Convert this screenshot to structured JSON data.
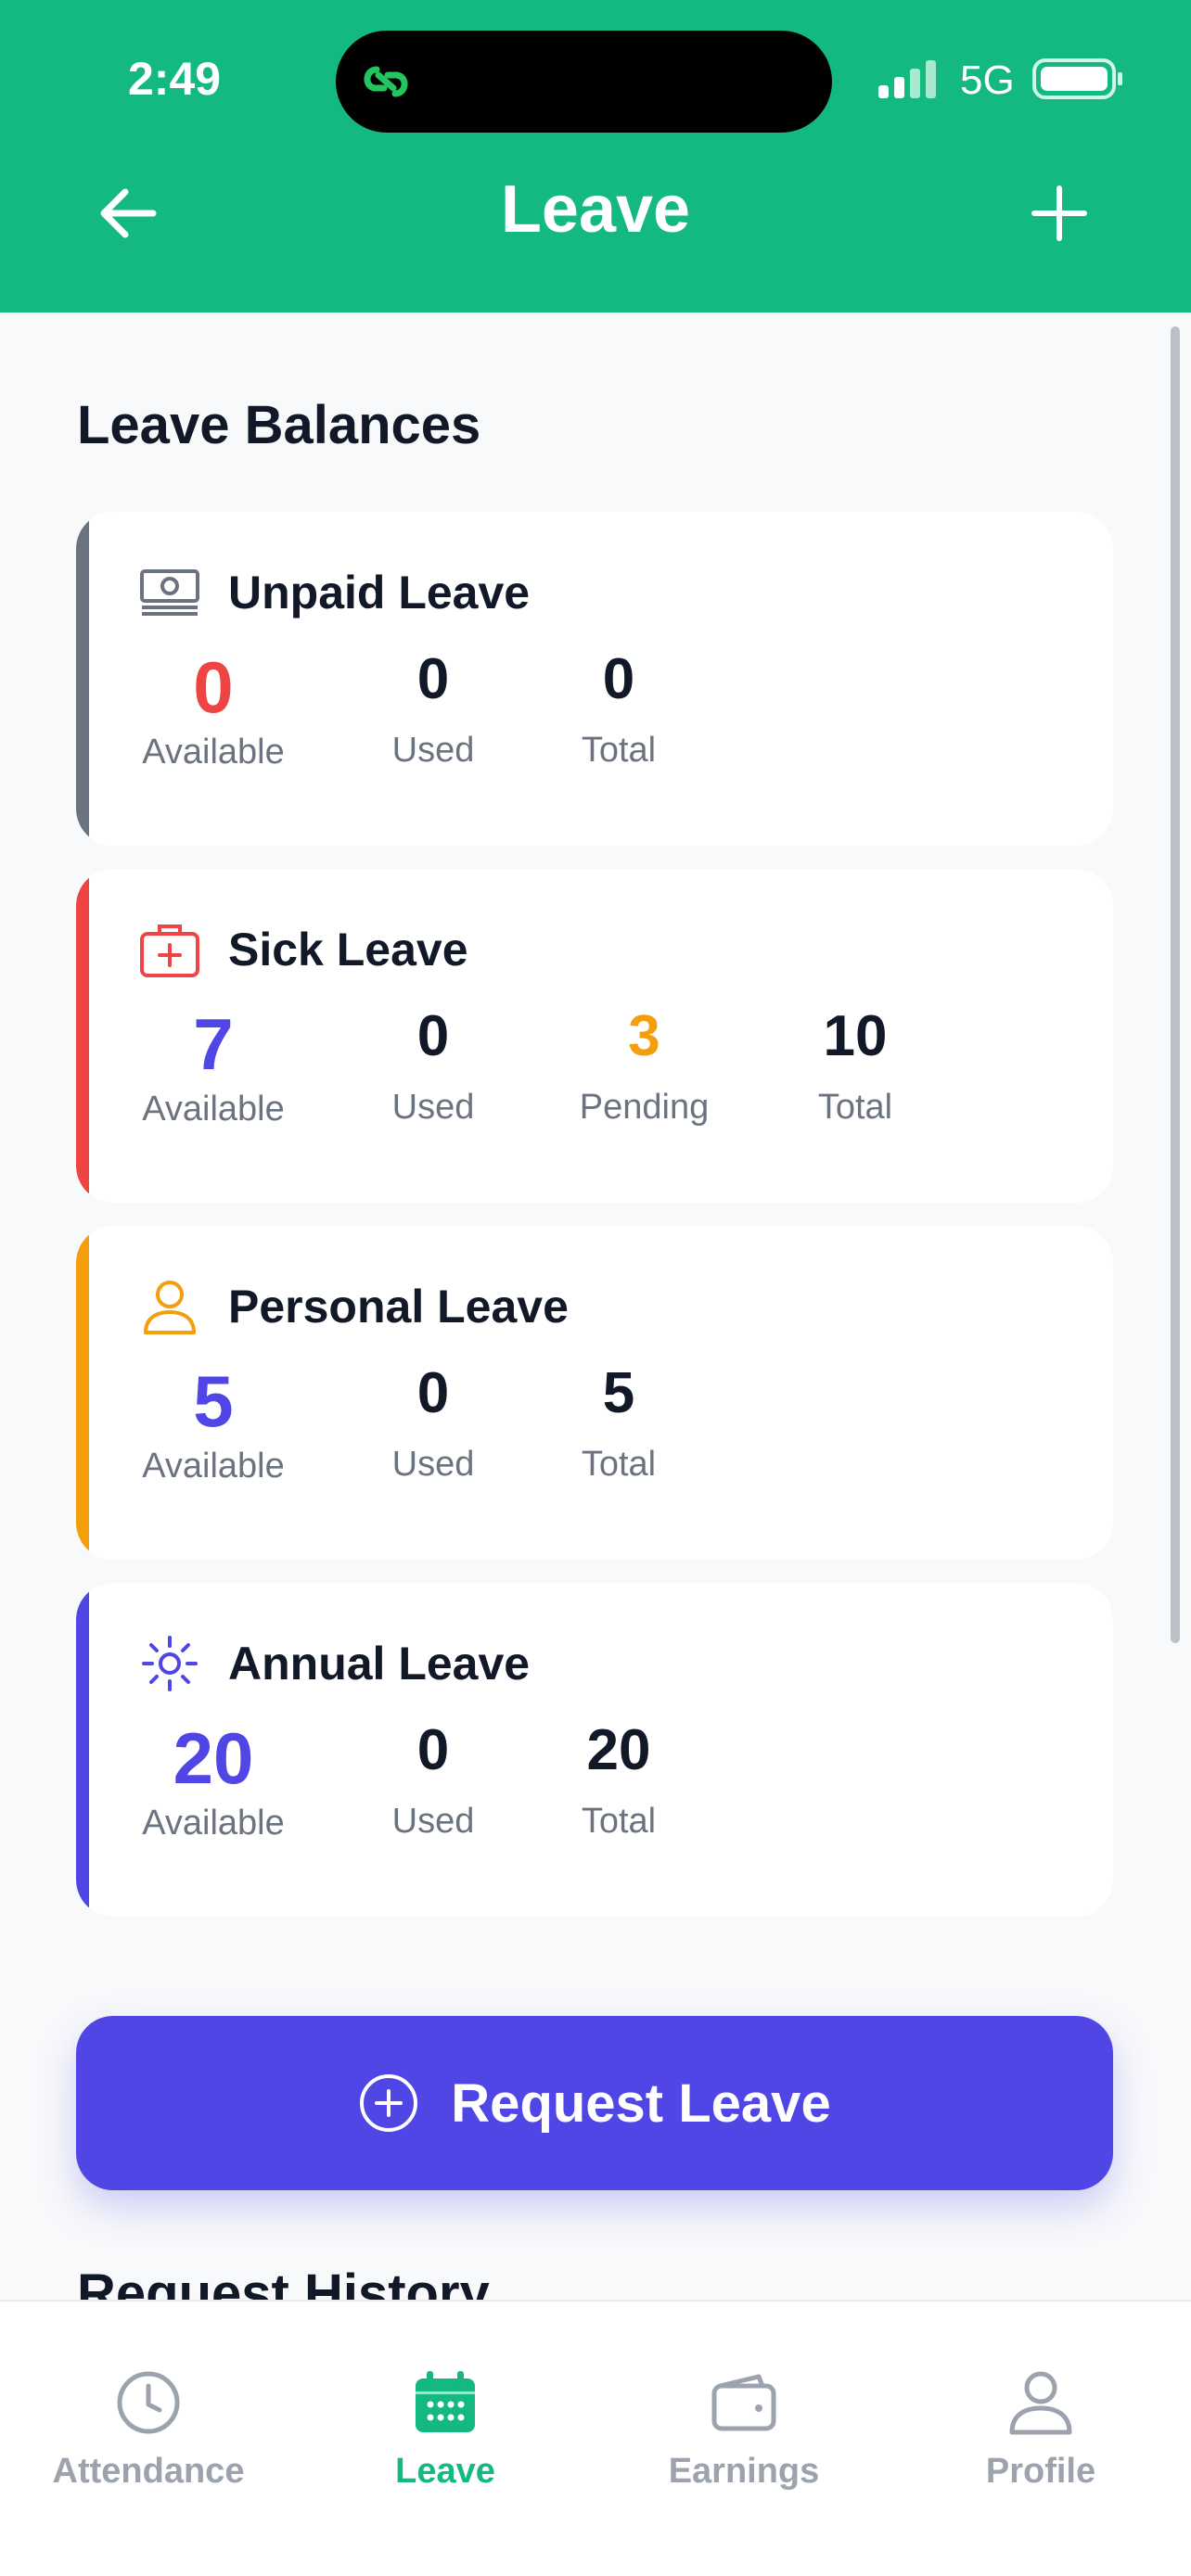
{
  "status_bar": {
    "time": "2:49",
    "network": "5G"
  },
  "header": {
    "title": "Leave"
  },
  "section_title": "Leave Balances",
  "colors": {
    "brand": "#13b981",
    "primary": "#4f46e5",
    "danger": "#ef4444",
    "warning": "#f59e0b",
    "neutral": "#6b7280"
  },
  "cards": [
    {
      "name": "Unpaid Leave",
      "icon": "money-icon",
      "accent": "#6b7280",
      "stats": [
        {
          "value": "0",
          "label": "Available",
          "color": "#ef4444"
        },
        {
          "value": "0",
          "label": "Used"
        },
        {
          "value": "0",
          "label": "Total"
        }
      ]
    },
    {
      "name": "Sick Leave",
      "icon": "medical-kit-icon",
      "accent": "#ef4444",
      "stats": [
        {
          "value": "7",
          "label": "Available",
          "color": "#4f46e5"
        },
        {
          "value": "0",
          "label": "Used"
        },
        {
          "value": "3",
          "label": "Pending",
          "color": "#f59e0b"
        },
        {
          "value": "10",
          "label": "Total"
        }
      ]
    },
    {
      "name": "Personal Leave",
      "icon": "person-icon",
      "accent": "#f59e0b",
      "stats": [
        {
          "value": "5",
          "label": "Available",
          "color": "#4f46e5"
        },
        {
          "value": "0",
          "label": "Used"
        },
        {
          "value": "5",
          "label": "Total"
        }
      ]
    },
    {
      "name": "Annual Leave",
      "icon": "sun-icon",
      "accent": "#4f46e5",
      "stats": [
        {
          "value": "20",
          "label": "Available",
          "color": "#4f46e5"
        },
        {
          "value": "0",
          "label": "Used"
        },
        {
          "value": "20",
          "label": "Total"
        }
      ]
    }
  ],
  "request_button": {
    "label": "Request Leave"
  },
  "history_title": "Request History",
  "tabs": [
    {
      "label": "Attendance",
      "icon": "clock-icon",
      "active": false
    },
    {
      "label": "Leave",
      "icon": "calendar-icon",
      "active": true
    },
    {
      "label": "Earnings",
      "icon": "wallet-icon",
      "active": false
    },
    {
      "label": "Profile",
      "icon": "user-icon",
      "active": false
    }
  ]
}
